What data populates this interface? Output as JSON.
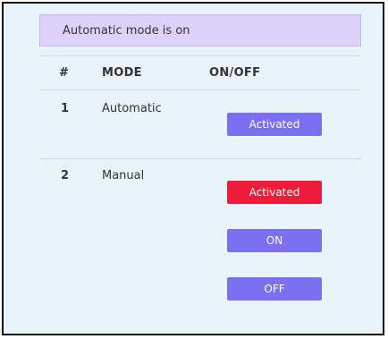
{
  "banner": {
    "text": "Automatic mode is on"
  },
  "table": {
    "headers": [
      "#",
      "MODE",
      "ON/OFF"
    ],
    "rows": [
      {
        "index": "1",
        "mode": "Automatic",
        "buttons": [
          {
            "label": "Activated",
            "color": "#7b6ff2"
          }
        ]
      },
      {
        "index": "2",
        "mode": "Manual",
        "buttons": [
          {
            "label": "Activated",
            "color": "#ec1c3a"
          },
          {
            "label": "ON",
            "color": "#7b6ff2"
          },
          {
            "label": "OFF",
            "color": "#7b6ff2"
          }
        ]
      }
    ]
  }
}
